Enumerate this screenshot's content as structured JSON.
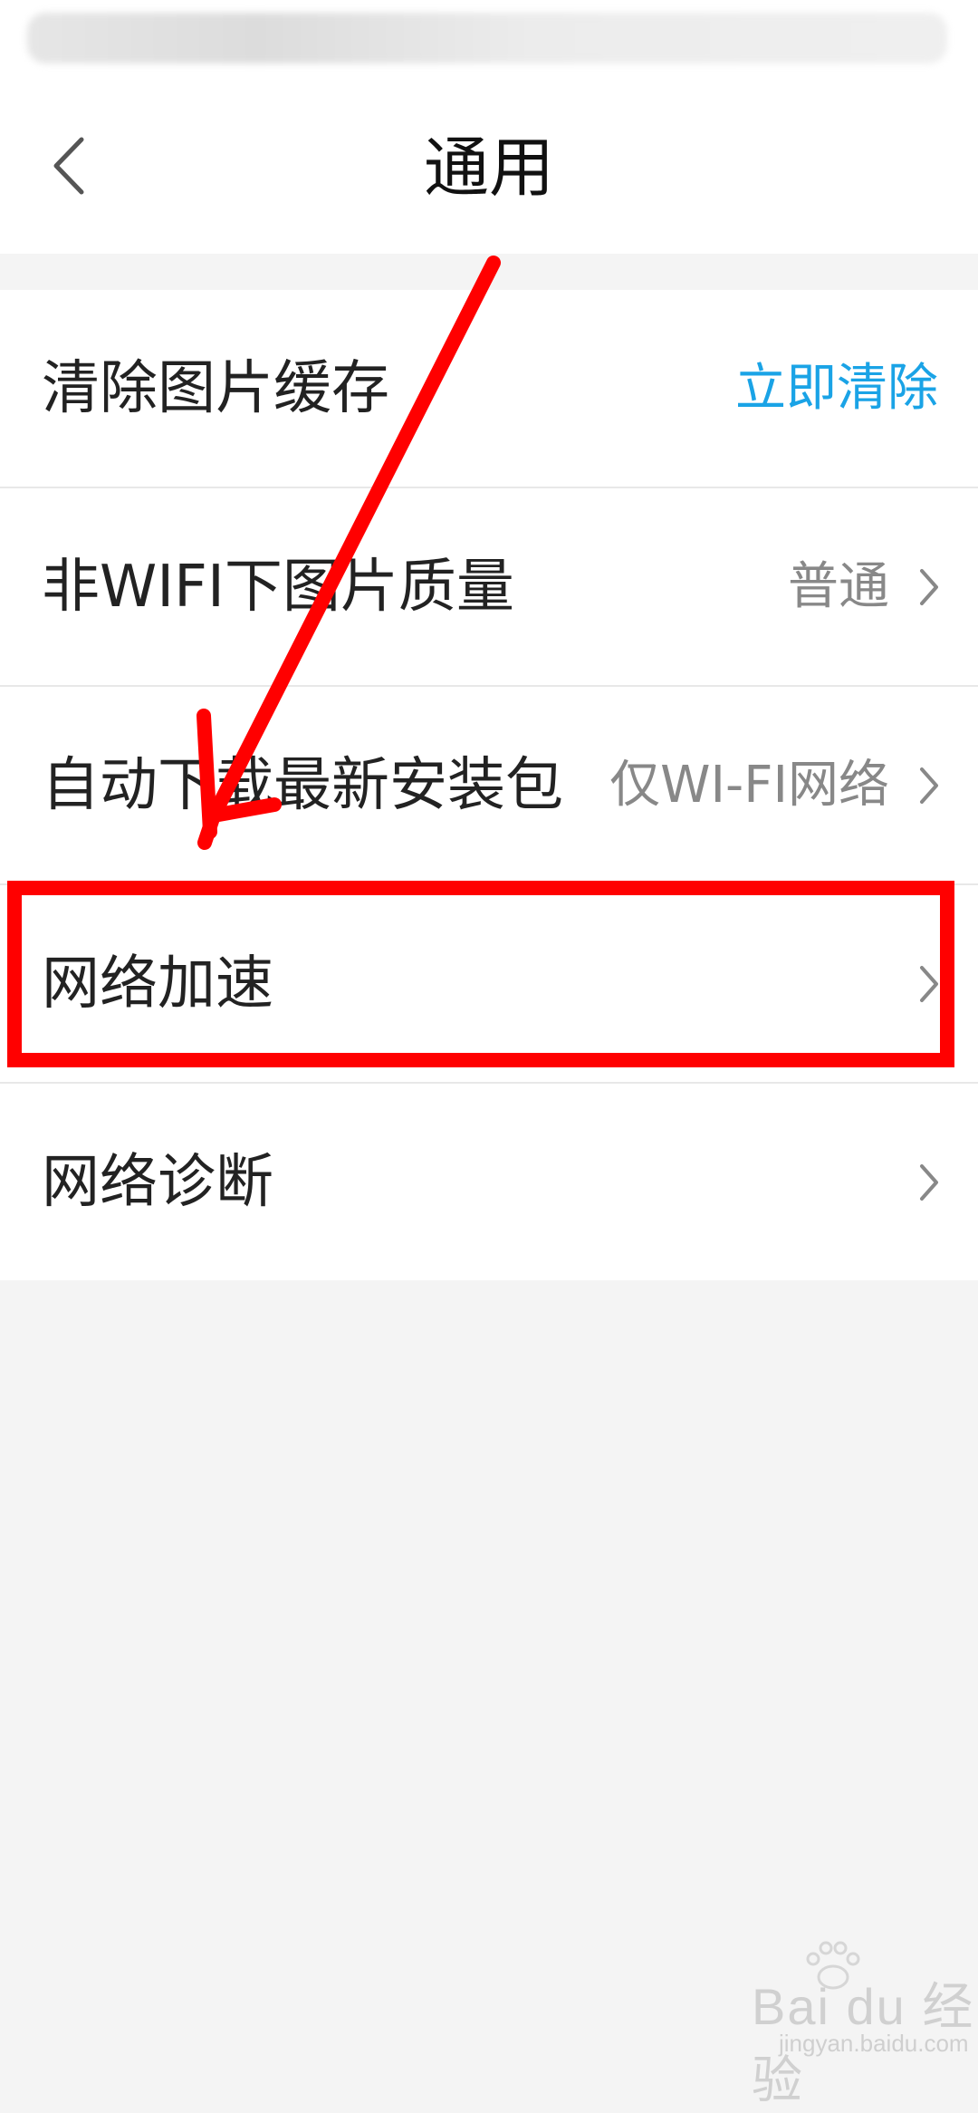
{
  "nav": {
    "title": "通用",
    "back_icon": "chevron-left-icon"
  },
  "settings": [
    {
      "label": "清除图片缓存",
      "action": "立即清除"
    },
    {
      "label": "非WIFI下图片质量",
      "value": "普通"
    },
    {
      "label": "自动下载最新安装包",
      "value": "仅WI-FI网络"
    },
    {
      "label": "网络加速"
    },
    {
      "label": "网络诊断"
    }
  ],
  "watermark": {
    "brand": "Bai du 经验",
    "url": "jingyan.baidu.com"
  },
  "colors": {
    "accent": "#1aa3e6",
    "annotation": "#ff0000",
    "background": "#f4f4f4"
  }
}
